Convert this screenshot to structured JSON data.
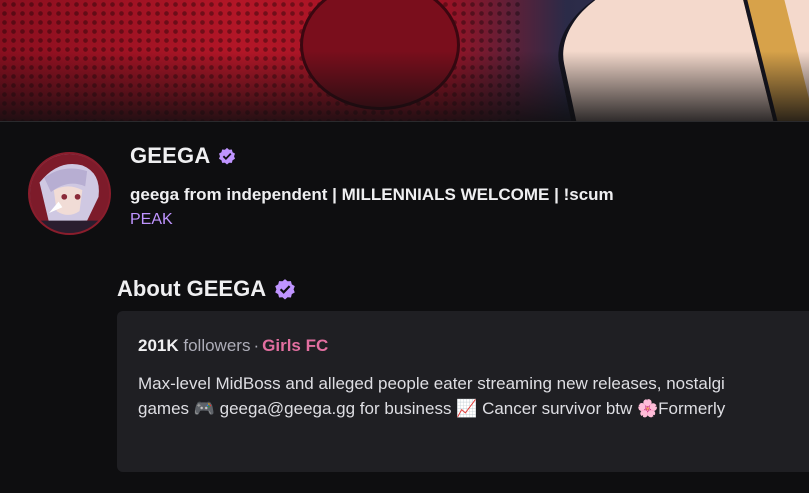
{
  "channel": {
    "name": "GEEGA",
    "stream_title": "geega from independent | MILLENNIALS WELCOME | !scum",
    "category": "PEAK"
  },
  "about": {
    "heading": "About GEEGA",
    "followers_count": "201K",
    "followers_label": "followers",
    "separator": "·",
    "team": "Girls FC",
    "bio_line1": "Max-level MidBoss and alleged people eater streaming new releases, nostalgi",
    "bio_line2": "games 🎮 geega@geega.gg for business 📈 Cancer survivor btw 🌸Formerly"
  },
  "colors": {
    "accent": "#bf94ff",
    "team": "#e26fa0",
    "background": "#0e0e10",
    "card": "#1f1f23"
  },
  "icons": {
    "verified": "verified-badge-icon"
  }
}
